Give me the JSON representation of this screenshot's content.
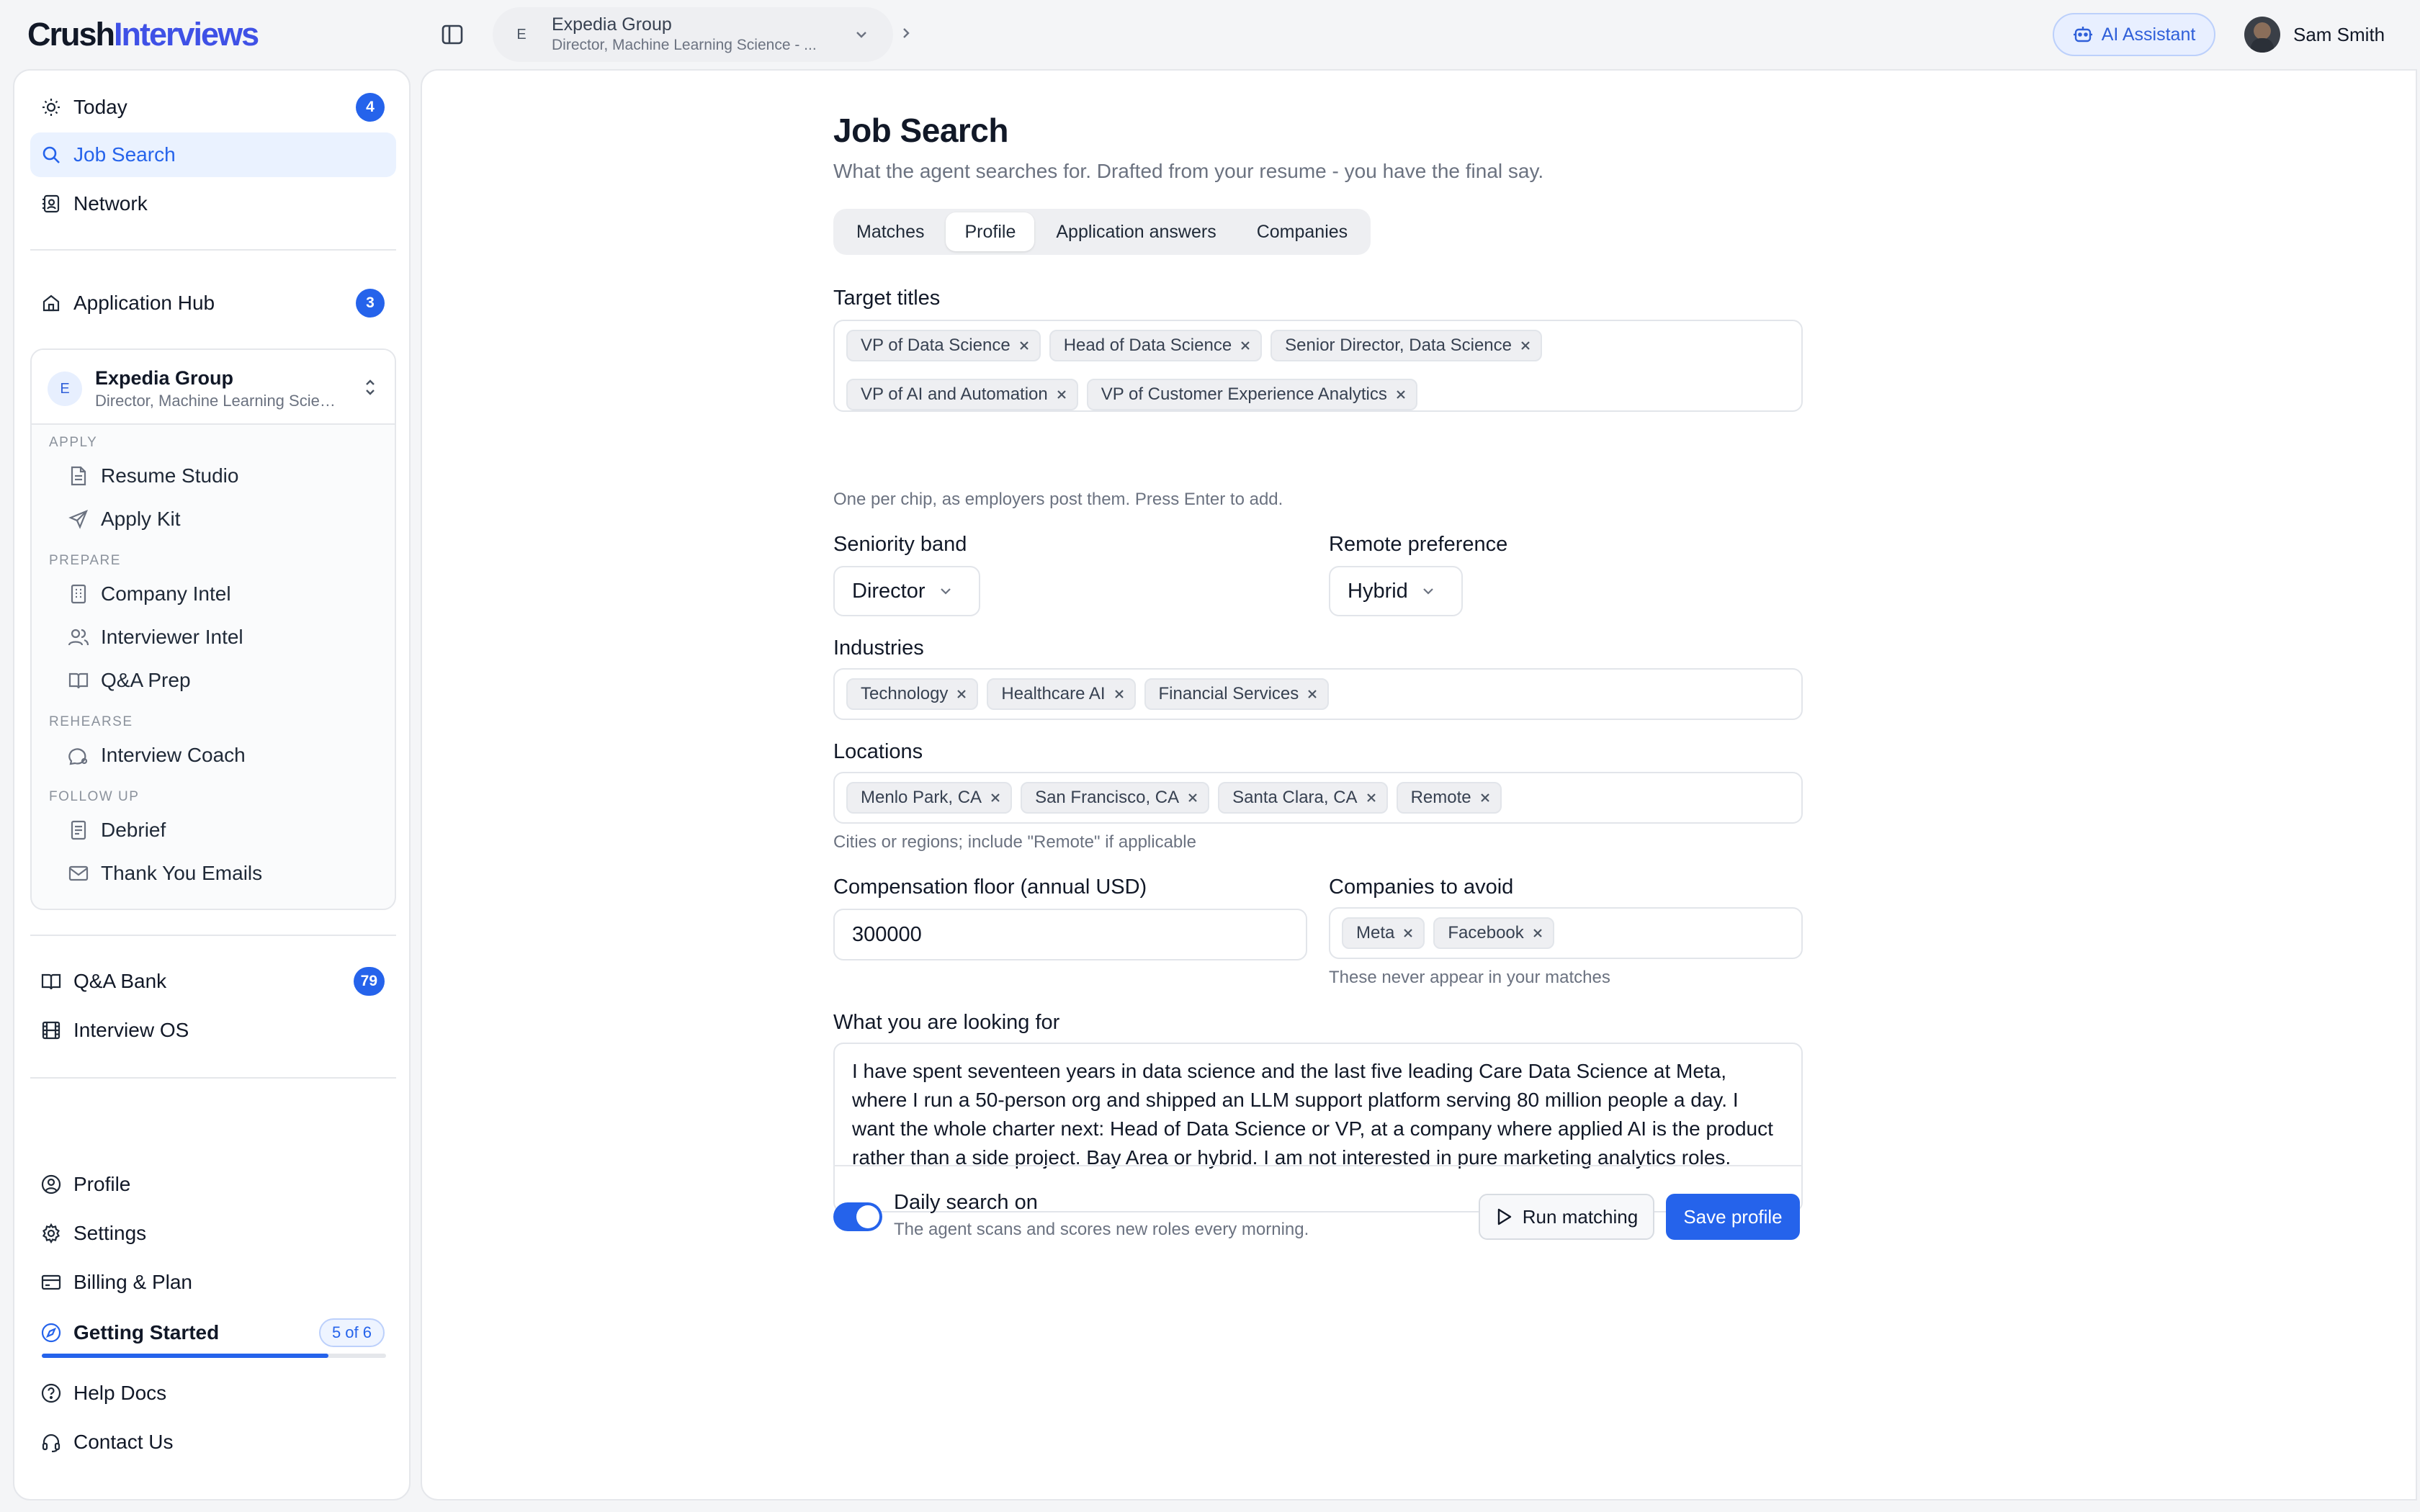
{
  "app": {
    "logo_part1": "Crush",
    "logo_part2": "Interviews"
  },
  "header": {
    "context_avatar": "E",
    "context_name": "Expedia Group",
    "context_sub": "Director, Machine Learning Science - ...",
    "ai_assistant_label": "AI Assistant",
    "user_name": "Sam Smith"
  },
  "sidebar": {
    "top_items": [
      {
        "label": "Today",
        "badge": "4",
        "icon": "sun-icon"
      },
      {
        "label": "Job Search",
        "icon": "search-icon",
        "active": true
      },
      {
        "label": "Network",
        "icon": "contacts-icon"
      }
    ],
    "application_hub": {
      "label": "Application Hub",
      "badge": "3",
      "icon": "home-icon"
    },
    "group": {
      "avatar": "E",
      "name": "Expedia Group",
      "sub": "Director, Machine Learning Science - Expedia Group",
      "sections": [
        {
          "label": "APPLY",
          "items": [
            {
              "label": "Resume Studio",
              "icon": "document-icon"
            },
            {
              "label": "Apply Kit",
              "icon": "send-icon"
            }
          ]
        },
        {
          "label": "PREPARE",
          "items": [
            {
              "label": "Company Intel",
              "icon": "building-icon"
            },
            {
              "label": "Interviewer Intel",
              "icon": "users-icon"
            },
            {
              "label": "Q&A Prep",
              "icon": "book-icon"
            }
          ]
        },
        {
          "label": "REHEARSE",
          "items": [
            {
              "label": "Interview Coach",
              "icon": "chat-icon"
            }
          ]
        },
        {
          "label": "FOLLOW UP",
          "items": [
            {
              "label": "Debrief",
              "icon": "notes-icon"
            },
            {
              "label": "Thank You Emails",
              "icon": "mail-icon"
            }
          ]
        }
      ]
    },
    "mid_items": [
      {
        "label": "Q&A Bank",
        "badge": "79",
        "icon": "book-icon"
      },
      {
        "label": "Interview OS",
        "icon": "film-icon"
      }
    ],
    "bottom_items": [
      {
        "label": "Profile",
        "icon": "user-circle-icon"
      },
      {
        "label": "Settings",
        "icon": "gear-icon"
      },
      {
        "label": "Billing & Plan",
        "icon": "card-icon"
      }
    ],
    "getting_started": {
      "label": "Getting Started",
      "progress_label": "5 of 6",
      "progress": 0.833
    },
    "help_items": [
      {
        "label": "Help Docs",
        "icon": "help-icon"
      },
      {
        "label": "Contact Us",
        "icon": "headset-icon"
      }
    ]
  },
  "main": {
    "title": "Job Search",
    "subtitle": "What the agent searches for. Drafted from your resume - you have the final say.",
    "tabs": [
      {
        "label": "Matches"
      },
      {
        "label": "Profile",
        "active": true
      },
      {
        "label": "Application answers"
      },
      {
        "label": "Companies"
      }
    ],
    "target_titles": {
      "label": "Target titles",
      "chips": [
        "VP of Data Science",
        "Head of Data Science",
        "Senior Director, Data Science",
        "VP of AI and Automation",
        "VP of Customer Experience Analytics"
      ],
      "hint": "One per chip, as employers post them. Press Enter to add."
    },
    "seniority": {
      "label": "Seniority band",
      "value": "Director"
    },
    "remote": {
      "label": "Remote preference",
      "value": "Hybrid"
    },
    "industries": {
      "label": "Industries",
      "chips": [
        "Technology",
        "Healthcare AI",
        "Financial Services"
      ]
    },
    "locations": {
      "label": "Locations",
      "chips": [
        "Menlo Park, CA",
        "San Francisco, CA",
        "Santa Clara, CA",
        "Remote"
      ],
      "hint": "Cities or regions; include \"Remote\" if applicable"
    },
    "compensation": {
      "label": "Compensation floor (annual USD)",
      "value": "300000"
    },
    "avoid": {
      "label": "Companies to avoid",
      "chips": [
        "Meta",
        "Facebook"
      ],
      "hint": "These never appear in your matches"
    },
    "looking_for": {
      "label": "What you are looking for",
      "value": "I have spent seventeen years in data science and the last five leading Care Data Science at Meta, where I run a 50-person org and shipped an LLM support platform serving 80 million people a day. I want the whole charter next: Head of Data Science or VP, at a company where applied AI is the product rather than a side project. Bay Area or hybrid. I am not interested in pure marketing analytics roles."
    },
    "daily_search": {
      "title": "Daily search on",
      "sub": "The agent scans and scores new roles every morning.",
      "on": true
    },
    "run_matching_label": "Run matching",
    "save_label": "Save profile"
  }
}
